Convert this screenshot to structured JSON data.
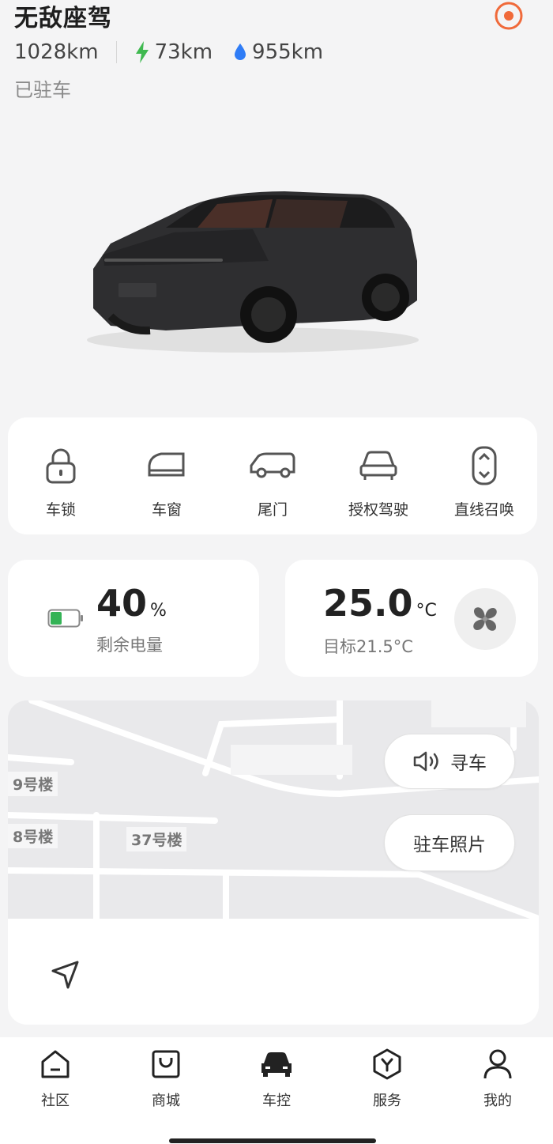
{
  "header": {
    "title": "无敌座驾",
    "total_range": "1028km",
    "electric_range": "73km",
    "fuel_range": "955km",
    "status": "已驻车"
  },
  "controls": [
    {
      "label": "车锁",
      "icon": "lock-icon"
    },
    {
      "label": "车窗",
      "icon": "window-icon"
    },
    {
      "label": "尾门",
      "icon": "tailgate-icon"
    },
    {
      "label": "授权驾驶",
      "icon": "car-icon"
    },
    {
      "label": "直线召唤",
      "icon": "summon-icon"
    }
  ],
  "battery": {
    "value": "40",
    "unit": "%",
    "label": "剩余电量",
    "level": 0.4
  },
  "climate": {
    "value": "25.0",
    "unit": "°C",
    "target": "目标21.5°C"
  },
  "map": {
    "find_car": "寻车",
    "parking_photo": "驻车照片",
    "buildings": [
      "9号楼",
      "8号楼",
      "37号楼"
    ]
  },
  "tabs": [
    {
      "label": "社区",
      "icon": "community-icon"
    },
    {
      "label": "商城",
      "icon": "shop-icon"
    },
    {
      "label": "车控",
      "icon": "car-control-icon"
    },
    {
      "label": "服务",
      "icon": "service-icon"
    },
    {
      "label": "我的",
      "icon": "profile-icon"
    }
  ],
  "colors": {
    "accent": "#f06a3a",
    "electric": "#3fb950",
    "fuel": "#2f7cf6",
    "battery_fill": "#34b356"
  }
}
